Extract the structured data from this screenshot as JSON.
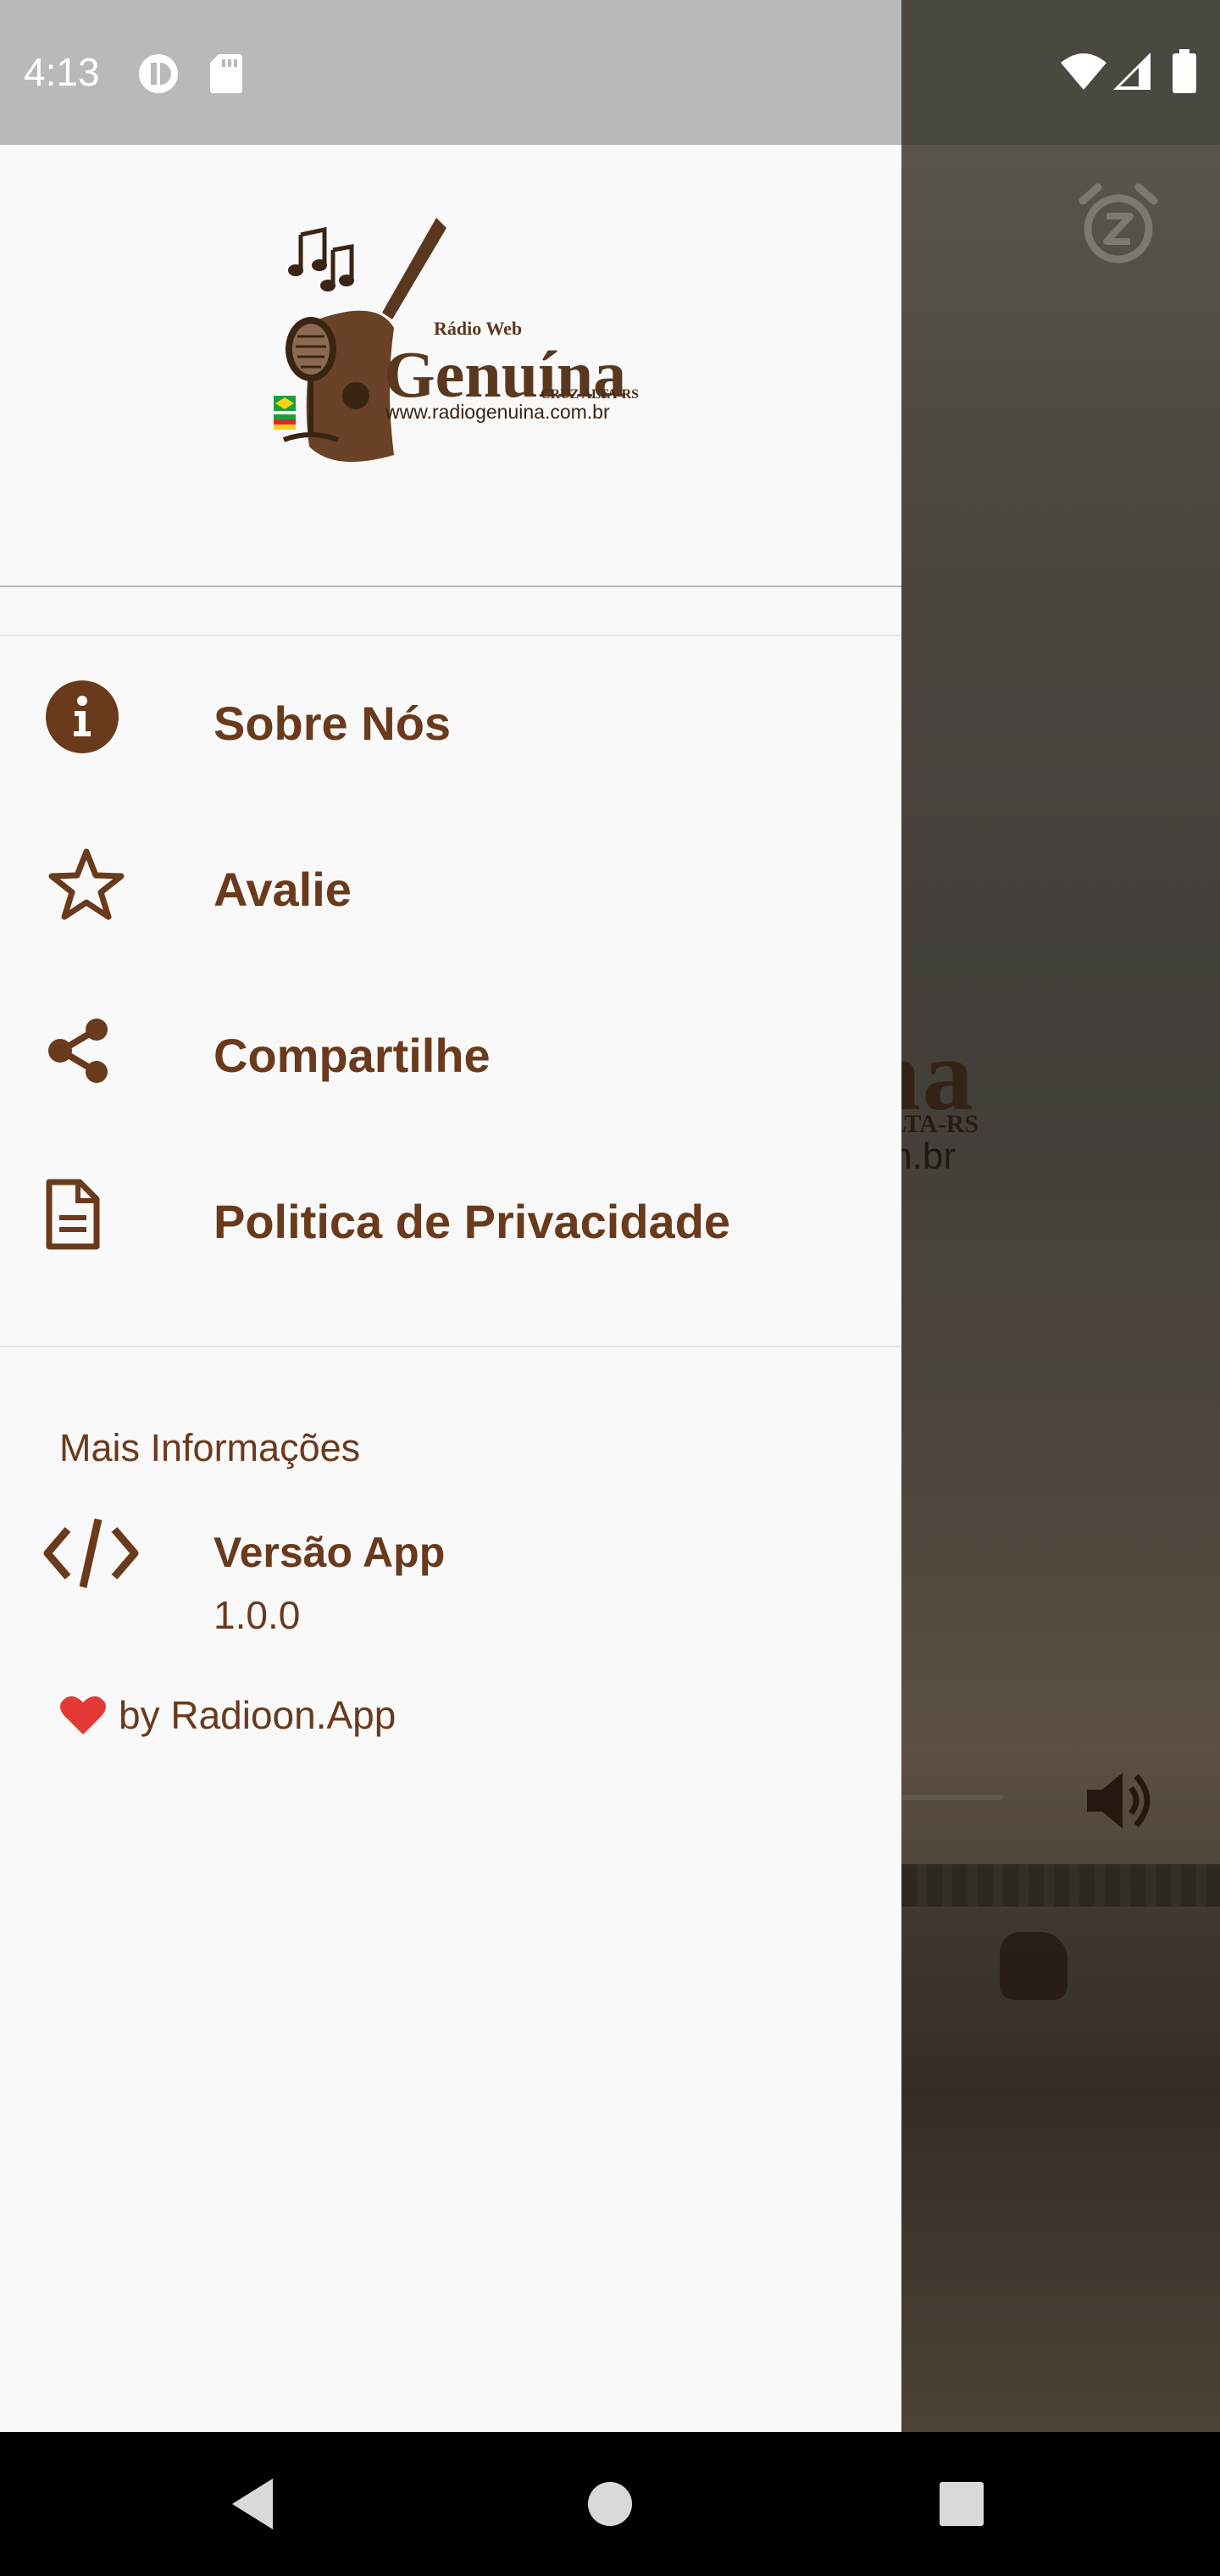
{
  "status_bar": {
    "time": "4:13",
    "left_icons": [
      "circle-app-icon",
      "sd-card-icon"
    ],
    "right_icons": [
      "wifi-icon",
      "cell-signal-icon",
      "battery-icon"
    ]
  },
  "background_app": {
    "logo_text": "na",
    "logo_sub": "LTA-RS",
    "logo_url": "m.br",
    "alarm_icon": "snooze-alarm-icon",
    "volume_icon": "volume-icon"
  },
  "drawer": {
    "logo": {
      "small_text": "Rádio Web",
      "title": "Genuína",
      "subtitle": "CRUZ ALTA-RS",
      "url": "www.radiogenuina.com.br"
    },
    "menu_items": [
      {
        "label": "Sobre Nós",
        "icon": "info-icon"
      },
      {
        "label": "Avalie",
        "icon": "star-icon"
      },
      {
        "label": "Compartilhe",
        "icon": "share-icon"
      },
      {
        "label": "Politica de Privacidade",
        "icon": "document-icon"
      }
    ],
    "more_info": {
      "title": "Mais Informações",
      "version_label": "Versão App",
      "version_value": "1.0.0",
      "credit": "by Radioon.App",
      "credit_icon": "heart-icon"
    }
  },
  "colors": {
    "accent": "#6a3a1c",
    "drawer_bg": "#f9f9f9",
    "heart": "#e53935"
  },
  "nav_bar": {
    "buttons": [
      "back-button",
      "home-button",
      "recents-button"
    ]
  }
}
